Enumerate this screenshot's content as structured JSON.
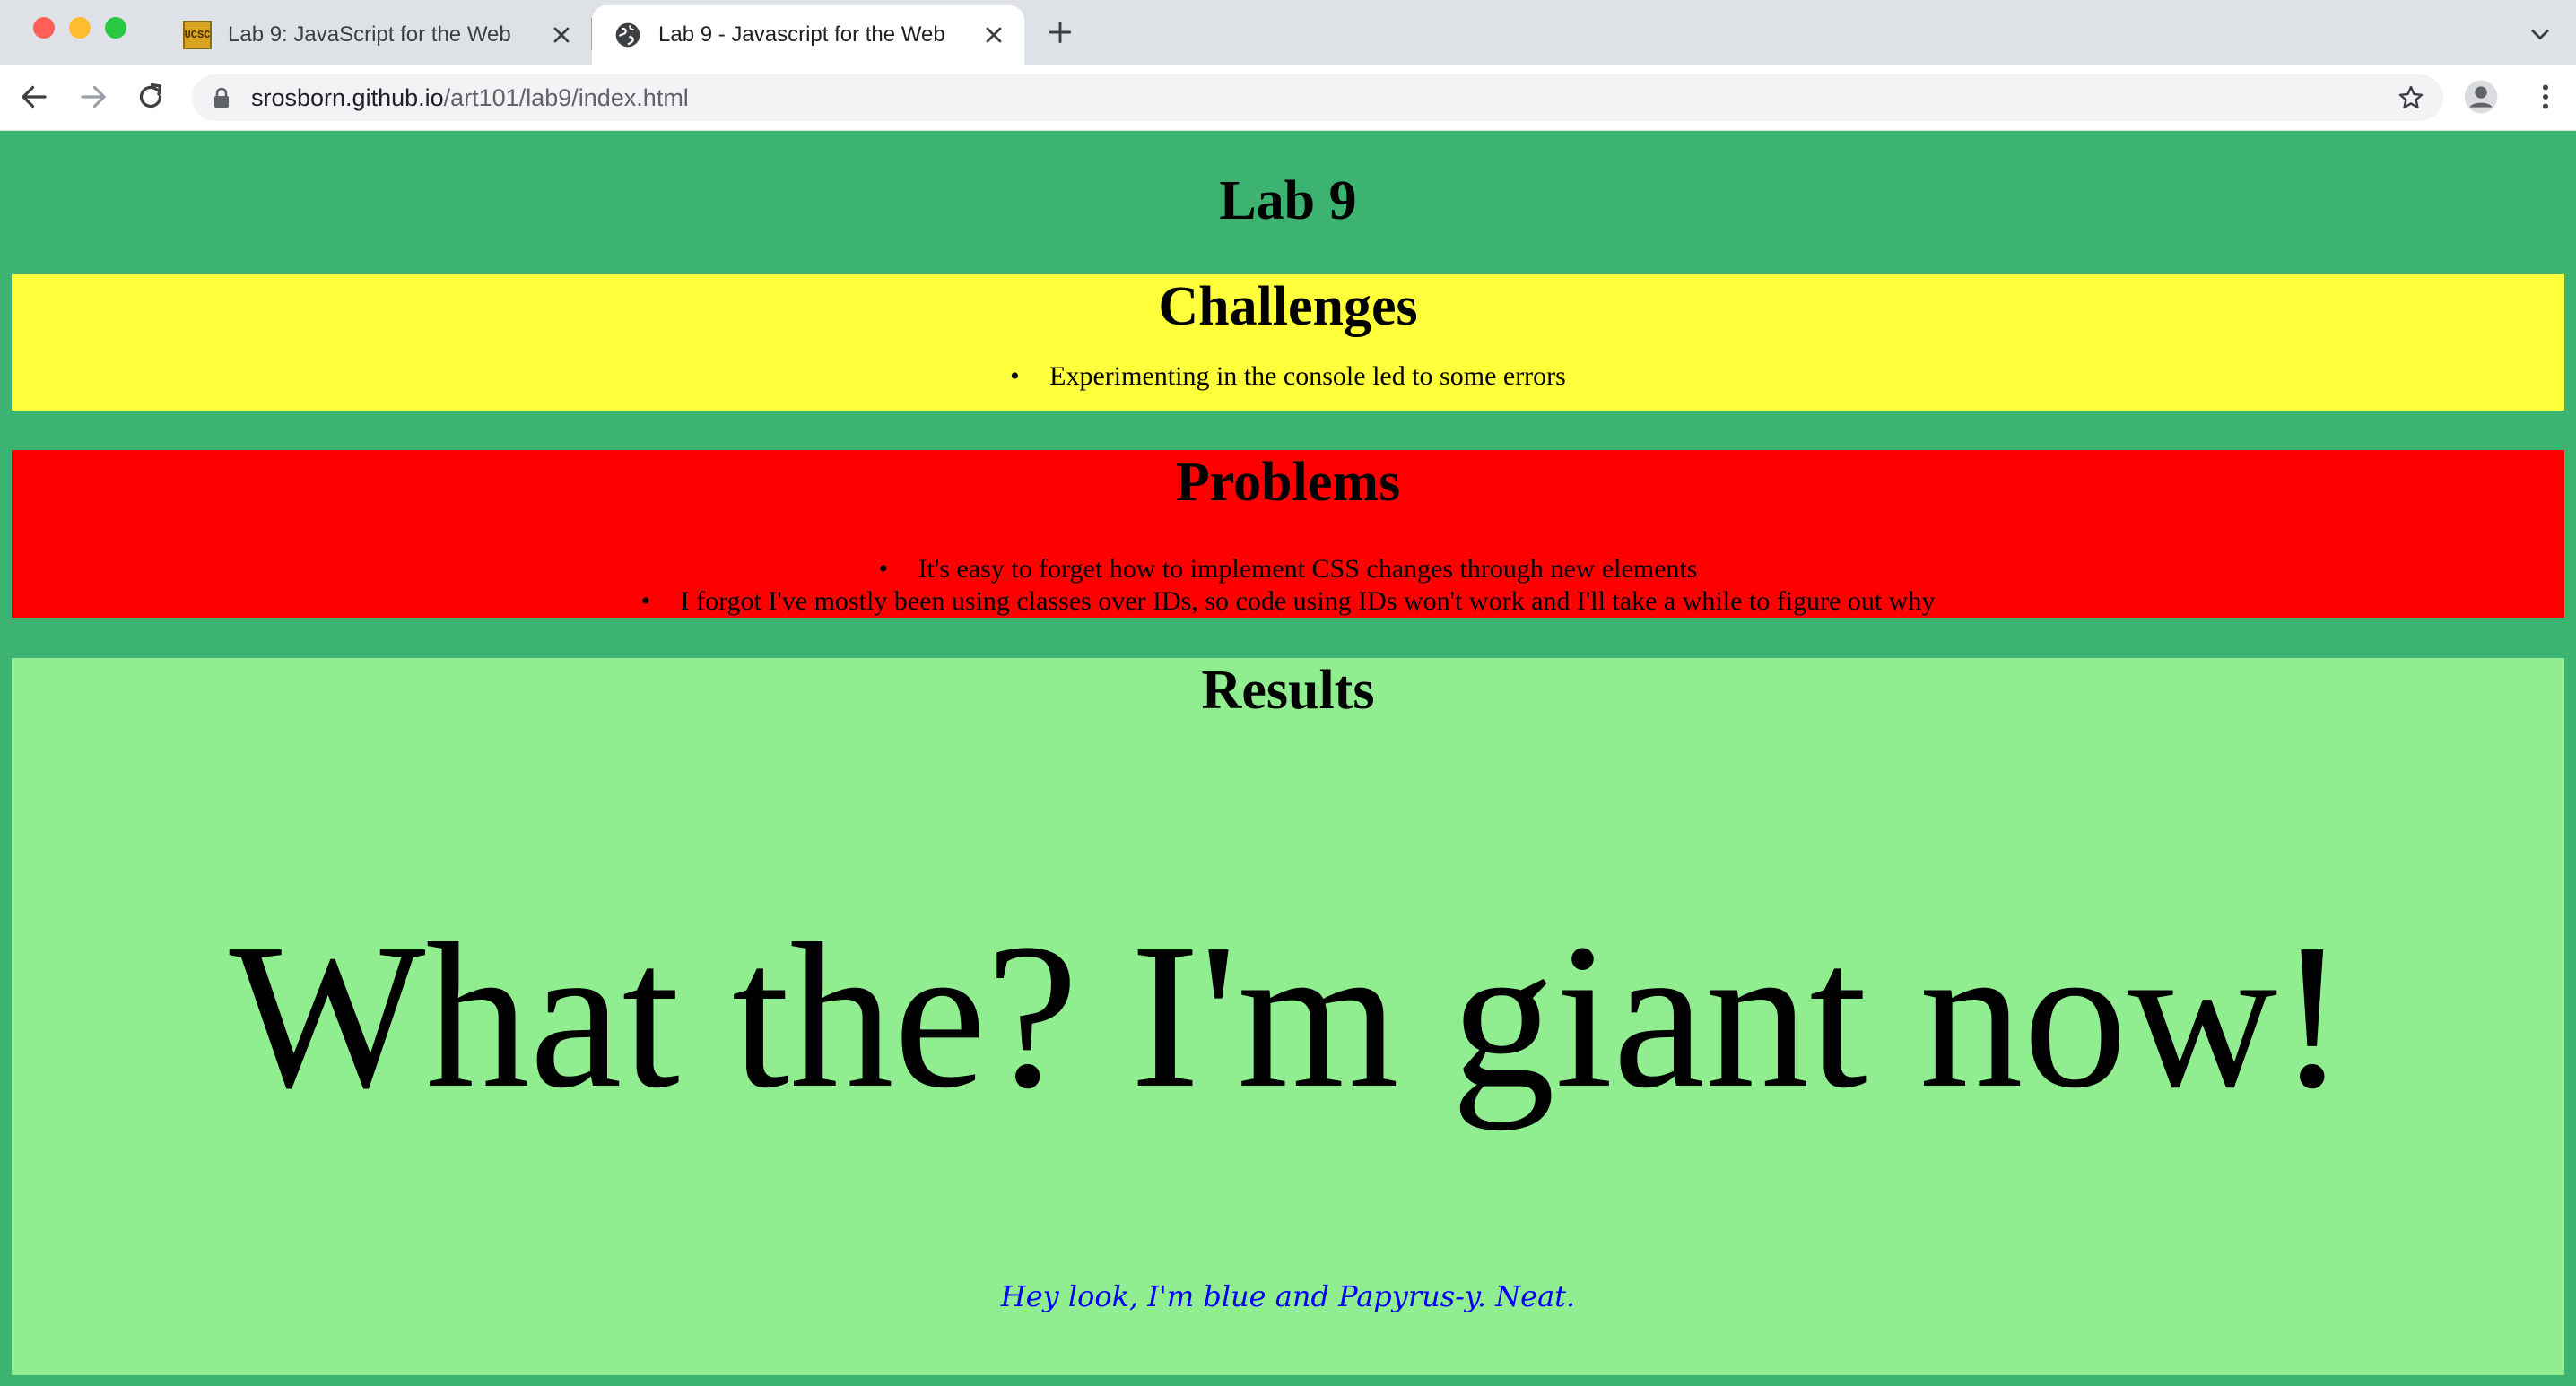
{
  "browser": {
    "tabs": [
      {
        "title": "Lab 9: JavaScript for the Web",
        "favicon": "ucsc-icon",
        "favicon_text": "UCSC",
        "active": false
      },
      {
        "title": "Lab 9 - Javascript for the Web",
        "favicon": "globe-icon",
        "active": true
      }
    ],
    "url_host": "srosborn.github.io",
    "url_path": "/art101/lab9/index.html"
  },
  "page": {
    "title": "Lab 9",
    "background": "#3cb371",
    "challenges": {
      "heading": "Challenges",
      "color": "#ffff3c",
      "items": [
        "Experimenting in the console led to some errors"
      ]
    },
    "problems": {
      "heading": "Problems",
      "color": "#ff0000",
      "items": [
        "It's easy to forget how to implement CSS changes through new elements",
        "I forgot I've mostly been using classes over IDs, so code using IDs won't work and I'll take a while to figure out why"
      ]
    },
    "results": {
      "heading": "Results",
      "color": "#90ee90",
      "giant_text": "What the? I'm giant now!",
      "blue_text": "Hey look, I'm blue and Papyrus-y. Neat.",
      "blue_color": "#0000ff"
    }
  }
}
